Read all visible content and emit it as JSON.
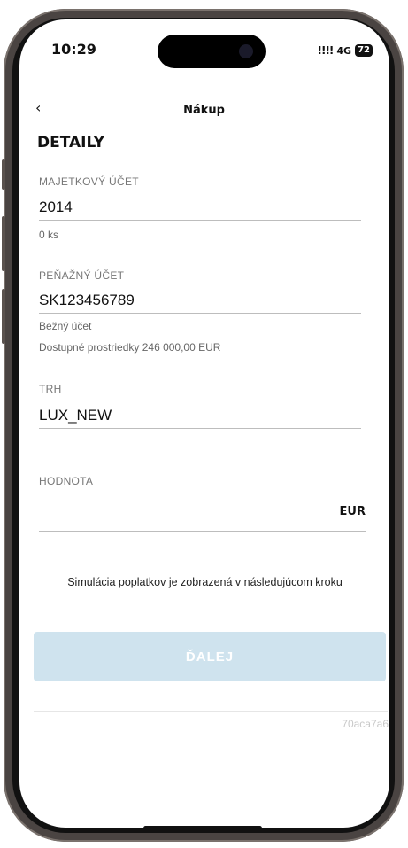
{
  "status_bar": {
    "time": "10:29",
    "signal": "!!!!",
    "network": "4G",
    "battery": "72"
  },
  "header": {
    "back_glyph": "‹",
    "title": "Nákup"
  },
  "section": {
    "title": "DETAILY"
  },
  "asset_account": {
    "label": "MAJETKOVÝ ÚČET",
    "value": "2014",
    "quantity": "0 ks"
  },
  "cash_account": {
    "label": "PEŇAŽNÝ ÚČET",
    "value": "SK123456789",
    "type": "Bežný účet",
    "available": "Dostupné prostriedky 246 000,00 EUR"
  },
  "market": {
    "label": "TRH",
    "value": "LUX_NEW"
  },
  "amount": {
    "label": "HODNOTA",
    "value": "",
    "currency": "EUR"
  },
  "note": "Simulácia poplatkov je zobrazená v následujúcom kroku",
  "next_button": {
    "label": "ĎALEJ"
  },
  "version": "70aca7a6",
  "colors": {
    "button_disabled_bg": "#cfe3ee",
    "button_text": "#ffffff",
    "rule": "#bdbdbd"
  }
}
